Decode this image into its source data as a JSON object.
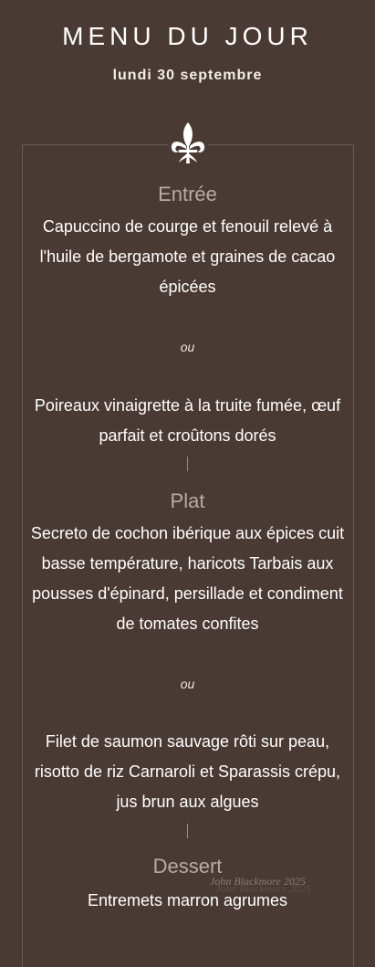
{
  "header": {
    "title": "MENU DU JOUR",
    "date": "lundi 30 septembre"
  },
  "icons": {
    "fleur": "fleur-de-lis-icon"
  },
  "entree": {
    "title": "Entrée",
    "dish1": "Capuccino de courge et fenouil relevé à l'huile de bergamote et graines de cacao épicées",
    "or": "ou",
    "dish2": "Poireaux vinaigrette à la truite fumée, œuf parfait et croûtons dorés"
  },
  "plat": {
    "title": "Plat",
    "dish1": "Secreto de cochon ibérique aux épices cuit basse température, haricots Tarbais aux pousses d'épinard, persillade et condiment de tomates confites",
    "or": "ou",
    "dish2": "Filet de saumon sauvage rôti sur peau, risotto de riz Carnaroli et Sparassis crépu, jus brun aux algues"
  },
  "dessert": {
    "title": "Dessert",
    "dish1": "Entremets marron agrumes"
  },
  "watermark": "John Blackmore 2025",
  "colors": {
    "background": "#4a3a34",
    "section_title": "#b8aba4",
    "text": "#ffffff"
  }
}
